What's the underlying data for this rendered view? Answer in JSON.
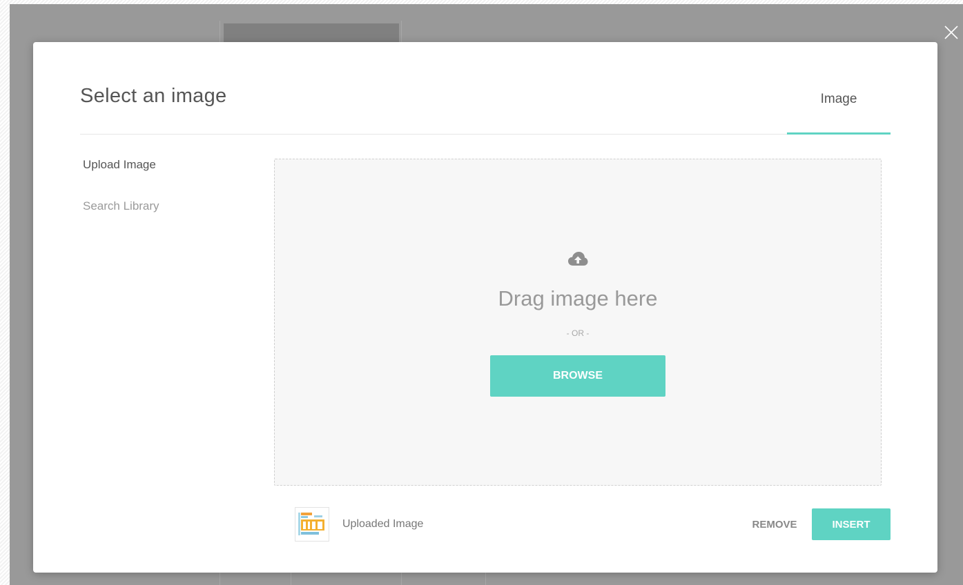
{
  "modal": {
    "title": "Select an image",
    "tab_label": "Image",
    "accent_color": "#5fd3c3"
  },
  "nav": {
    "items": [
      {
        "label": "Upload Image",
        "active": true
      },
      {
        "label": "Search Library",
        "active": false
      }
    ]
  },
  "dropzone": {
    "icon": "cloud-upload-icon",
    "drag_text": "Drag image here",
    "or_text": "- OR -",
    "browse_label": "BROWSE"
  },
  "footer": {
    "thumbnail_icon": "uploaded-image-thumbnail",
    "uploaded_label": "Uploaded Image",
    "remove_label": "REMOVE",
    "insert_label": "INSERT"
  },
  "overlay": {
    "close_icon": "close-icon"
  }
}
